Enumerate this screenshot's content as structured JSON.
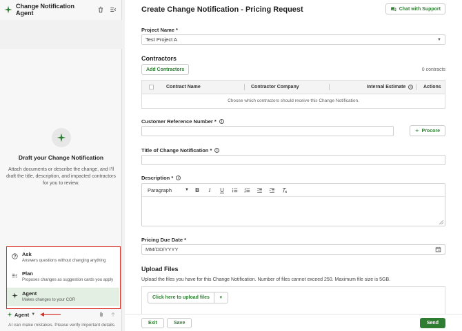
{
  "sidebar": {
    "title": "Change Notification Agent",
    "draft": {
      "title": "Draft your Change Notification",
      "description": "Attach documents or describe the change, and I'll draft the title, description, and impacted contractors for you to review."
    },
    "modes": [
      {
        "label": "Ask",
        "description": "Answers questions without changing anything",
        "icon": "question-circle-icon"
      },
      {
        "label": "Plan",
        "description": "Proposes changes as suggestion cards you apply",
        "icon": "plan-list-icon"
      },
      {
        "label": "Agent",
        "description": "Makes changes to your COR",
        "icon": "sparkle-icon",
        "active": true
      }
    ],
    "current_mode": "Agent",
    "disclaimer": "AI can make mistakes. Please verify important details."
  },
  "main": {
    "title": "Create Change Notification - Pricing Request",
    "chat_support": "Chat with Support",
    "project": {
      "label": "Project Name *",
      "value": "Test Project A"
    },
    "contractors": {
      "heading": "Contractors",
      "add_label": "Add Contractors",
      "count": "0 contracts",
      "columns": [
        "Contract Name",
        "Contractor Company",
        "Internal Estimate",
        "Actions"
      ],
      "empty": "Choose which contractors should receive this Change Notification."
    },
    "customer_ref": {
      "label": "Customer Reference Number *",
      "procore_label": "Procore",
      "value": ""
    },
    "title_field": {
      "label": "Title of Change Notification *",
      "value": ""
    },
    "description": {
      "label": "Description *",
      "paragraph_label": "Paragraph"
    },
    "due_date": {
      "label": "Pricing Due Date *",
      "placeholder": "MM/DD/YYYY"
    },
    "upload": {
      "heading": "Upload Files",
      "description": "Upload the files you have for this Change Notification. Number of files cannot exceed 250. Maximum file size is 5GB.",
      "button_label": "Click here to upload files"
    },
    "footer": {
      "exit": "Exit",
      "save": "Save",
      "send": "Send"
    }
  },
  "colors": {
    "accent": "#2e7d32",
    "highlight_border": "#d93025",
    "active_mode_bg": "#e3efe3"
  }
}
